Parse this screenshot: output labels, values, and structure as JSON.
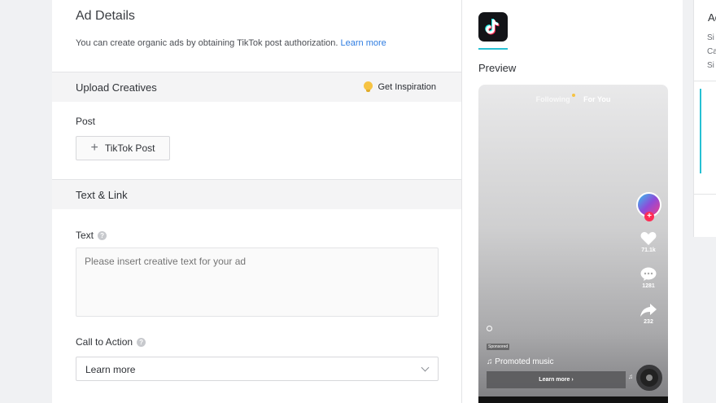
{
  "ad_details": {
    "title": "Ad Details",
    "subtitle": "You can create organic ads by obtaining TikTok post authorization.",
    "learn_more_link": "Learn more"
  },
  "upload_creatives": {
    "section_title": "Upload Creatives",
    "inspiration_label": "Get Inspiration",
    "post_label": "Post",
    "tiktok_post_button": "TikTok Post"
  },
  "text_link": {
    "section_title": "Text & Link",
    "text_label": "Text",
    "text_placeholder": "Please insert creative text for your ad",
    "cta_label": "Call to Action",
    "cta_value": "Learn more"
  },
  "preview": {
    "label": "Preview",
    "tabs": {
      "following": "Following",
      "for_you": "For You"
    },
    "likes": "71.1k",
    "comments": "1281",
    "shares": "232",
    "sponsored": "Sponsored",
    "music": "♫ Promoted music",
    "cta_bar": "Learn more"
  },
  "right_panel": {
    "title": "Ac",
    "lines": [
      "Si",
      "Ca",
      "Si"
    ]
  },
  "colors": {
    "accent": "#27c1d4",
    "link": "#2f7de1",
    "tiktok_red": "#fe2c55"
  }
}
